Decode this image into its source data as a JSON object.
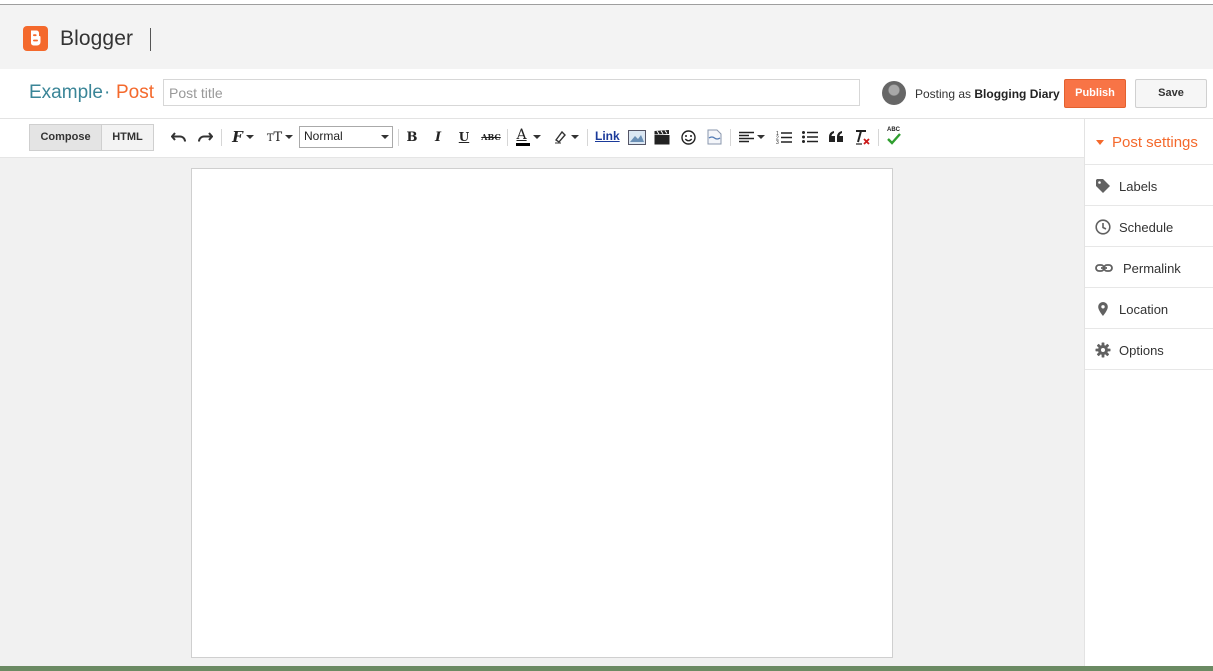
{
  "app": {
    "name": "Blogger"
  },
  "titlebar": {
    "blog_name": "Example",
    "separator": "·",
    "section": "Post",
    "title_placeholder": "Post title",
    "posting_as_prefix": "Posting as",
    "posting_as_name": "Blogging Diary",
    "publish_label": "Publish",
    "save_label": "Save"
  },
  "toolbar": {
    "compose_label": "Compose",
    "html_label": "HTML",
    "format_value": "Normal",
    "bold_label": "B",
    "italic_label": "I",
    "underline_label": "U",
    "strikethrough_label": "ABC",
    "text_color_label": "A",
    "link_label": "Link",
    "spellcheck_label": "ABC",
    "icons": [
      "undo-icon",
      "redo-icon",
      "font-icon",
      "font-size-icon",
      "highlight-icon",
      "image-icon",
      "video-icon",
      "emoji-icon",
      "jump-break-icon",
      "align-icon",
      "numbered-list-icon",
      "bulleted-list-icon",
      "quote-icon",
      "remove-format-icon",
      "spellcheck-icon"
    ]
  },
  "sidebar": {
    "heading": "Post settings",
    "items": [
      {
        "label": "Labels",
        "icon": "tag-icon"
      },
      {
        "label": "Schedule",
        "icon": "clock-icon"
      },
      {
        "label": "Permalink",
        "icon": "link-icon"
      },
      {
        "label": "Location",
        "icon": "pin-icon"
      },
      {
        "label": "Options",
        "icon": "gear-icon"
      }
    ]
  },
  "colors": {
    "accent": "#f4692c",
    "blog_name": "#3a8597",
    "publish": "#f87446"
  }
}
